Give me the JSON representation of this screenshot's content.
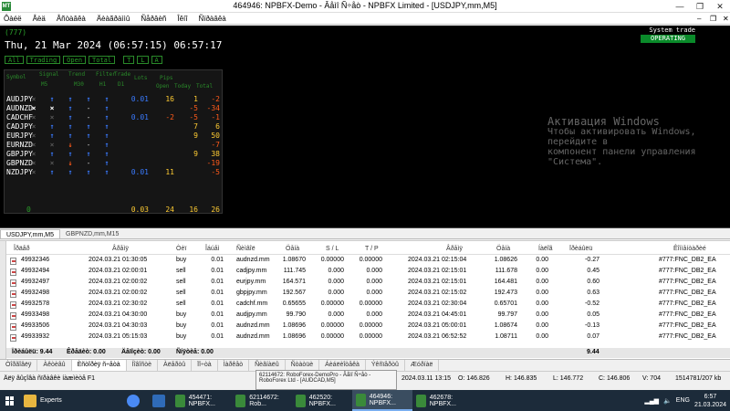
{
  "window": {
    "title": "464946: NPBFX-Demo - Âåìî Ñ÷åò - NPBFX Limited - [USDJPY,mm,M5]",
    "logo": "MT",
    "controls": [
      "—",
      "❐",
      "✕"
    ]
  },
  "menu": {
    "items": [
      "Ôàéë",
      "Âèä",
      "Âñòàâêà",
      "Äèàãðàììû",
      "Ñåðâèñ",
      "Îêíî",
      "Ñïðàâêà"
    ],
    "window_controls": [
      "–",
      "❐",
      "✕"
    ]
  },
  "chart": {
    "magic": "(777)",
    "datetime": "Thu, 21 Mar 2024 (06:57:15) 06:57:17",
    "filters": [
      "All",
      "Trading",
      "Open",
      "Total",
      "T",
      "L",
      "A"
    ],
    "system_label": "System trade",
    "system_status": "OPERATING",
    "table_headers": {
      "h1": "Symbol",
      "h2": "Signal",
      "h3": "Trend",
      "h4": "Filter",
      "h5": "Trade",
      "h6": "Lots",
      "h7": "Pips",
      "sub1": "M5",
      "sub2": "M30",
      "sub3": "H1",
      "sub4": "D1",
      "sub5": "Open",
      "sub6": "Today",
      "sub7": "Total"
    },
    "rows": [
      {
        "symbol": "AUDJPY",
        "c1": "×",
        "c2": "↑",
        "c3": "↑",
        "c4": "↑",
        "c5": "↑",
        "lots": "0.01",
        "open": "16",
        "today": "1",
        "total": "-2"
      },
      {
        "symbol": "AUDNZD",
        "c1": "×",
        "c2": "×",
        "c3": "↑",
        "c4": "-",
        "c5": "↑",
        "lots": "",
        "open": "",
        "today": "-5",
        "total": "-34"
      },
      {
        "symbol": "CADCHF",
        "c1": "×",
        "c2": "×",
        "c3": "↑",
        "c4": "-",
        "c5": "↑",
        "lots": "0.01",
        "open": "-2",
        "today": "-5",
        "total": "-1"
      },
      {
        "symbol": "CADJPY",
        "c1": "×",
        "c2": "↑",
        "c3": "↑",
        "c4": "↑",
        "c5": "↑",
        "lots": "",
        "open": "",
        "today": "7",
        "total": "6"
      },
      {
        "symbol": "EURJPY",
        "c1": "×",
        "c2": "↑",
        "c3": "↑",
        "c4": "↑",
        "c5": "↑",
        "lots": "",
        "open": "",
        "today": "9",
        "total": "50"
      },
      {
        "symbol": "EURNZD",
        "c1": "×",
        "c2": "×",
        "c3": "↓",
        "c4": "-",
        "c5": "↑",
        "lots": "",
        "open": "",
        "today": "",
        "total": "-7"
      },
      {
        "symbol": "GBPJPY",
        "c1": "×",
        "c2": "↑",
        "c3": "↑",
        "c4": "↑",
        "c5": "↑",
        "lots": "",
        "open": "",
        "today": "9",
        "total": "38"
      },
      {
        "symbol": "GBPNZD",
        "c1": "×",
        "c2": "×",
        "c3": "↓",
        "c4": "-",
        "c5": "↑",
        "lots": "",
        "open": "",
        "today": "",
        "total": "-19"
      },
      {
        "symbol": "NZDJPY",
        "c1": "×",
        "c2": "↑",
        "c3": "↑",
        "c4": "↑",
        "c5": "↑",
        "lots": "0.01",
        "open": "11",
        "today": "",
        "total": "-5"
      }
    ],
    "totals": {
      "zero": "0",
      "lots": "0.03",
      "open": "24",
      "today": "16",
      "total": "26"
    },
    "watermark_line1": "Активация Windows",
    "watermark_line2": "Чтобы активировать Windows, перейдите в",
    "watermark_line3": "компонент панели управления \"Система\"."
  },
  "chart_tabs": [
    "USDJPY,mm,M5",
    "GBPNZD,mm,M15"
  ],
  "terminal": {
    "headers": [
      "Îðäåð",
      "Âðåìÿ",
      "Òèï",
      "Îáúåì",
      "Ñèìâîë",
      "Öåíà",
      "S / L",
      "T / P",
      "Âðåìÿ",
      "Öåíà",
      "Íàëîã",
      "Ïðèáûëü",
      "Êîììåíòàðèé"
    ],
    "rows": [
      {
        "order": "49932346",
        "time": "2024.03.21 01:30:05",
        "type": "buy",
        "volume": "0.01",
        "symbol": "audnzd.mm",
        "price": "1.08670",
        "sl": "0.00000",
        "tp": "0.00000",
        "ctime": "2024.03.21 02:15:04",
        "cprice": "1.08626",
        "tax": "0.00",
        "profit": "-0.27",
        "comment": "#777:FNC_DB2_EA"
      },
      {
        "order": "49932494",
        "time": "2024.03.21 02:00:01",
        "type": "sell",
        "volume": "0.01",
        "symbol": "cadjpy.mm",
        "price": "111.745",
        "sl": "0.000",
        "tp": "0.000",
        "ctime": "2024.03.21 02:15:01",
        "cprice": "111.678",
        "tax": "0.00",
        "profit": "0.45",
        "comment": "#777:FNC_DB2_EA"
      },
      {
        "order": "49932497",
        "time": "2024.03.21 02:00:02",
        "type": "sell",
        "volume": "0.01",
        "symbol": "eurjpy.mm",
        "price": "164.571",
        "sl": "0.000",
        "tp": "0.000",
        "ctime": "2024.03.21 02:15:01",
        "cprice": "164.481",
        "tax": "0.00",
        "profit": "0.60",
        "comment": "#777:FNC_DB2_EA"
      },
      {
        "order": "49932498",
        "time": "2024.03.21 02:00:02",
        "type": "sell",
        "volume": "0.01",
        "symbol": "gbpjpy.mm",
        "price": "192.567",
        "sl": "0.000",
        "tp": "0.000",
        "ctime": "2024.03.21 02:15:02",
        "cprice": "192.473",
        "tax": "0.00",
        "profit": "0.63",
        "comment": "#777:FNC_DB2_EA"
      },
      {
        "order": "49932578",
        "time": "2024.03.21 02:30:02",
        "type": "sell",
        "volume": "0.01",
        "symbol": "cadchf.mm",
        "price": "0.65655",
        "sl": "0.00000",
        "tp": "0.00000",
        "ctime": "2024.03.21 02:30:04",
        "cprice": "0.65701",
        "tax": "0.00",
        "profit": "-0.52",
        "comment": "#777:FNC_DB2_EA"
      },
      {
        "order": "49933498",
        "time": "2024.03.21 04:30:00",
        "type": "buy",
        "volume": "0.01",
        "symbol": "audjpy.mm",
        "price": "99.790",
        "sl": "0.000",
        "tp": "0.000",
        "ctime": "2024.03.21 04:45:01",
        "cprice": "99.797",
        "tax": "0.00",
        "profit": "0.05",
        "comment": "#777:FNC_DB2_EA"
      },
      {
        "order": "49933506",
        "time": "2024.03.21 04:30:03",
        "type": "buy",
        "volume": "0.01",
        "symbol": "audnzd.mm",
        "price": "1.08696",
        "sl": "0.00000",
        "tp": "0.00000",
        "ctime": "2024.03.21 05:00:01",
        "cprice": "1.08674",
        "tax": "0.00",
        "profit": "-0.13",
        "comment": "#777:FNC_DB2_EA"
      },
      {
        "order": "49933932",
        "time": "2024.03.21 05:15:03",
        "type": "buy",
        "volume": "0.01",
        "symbol": "audnzd.mm",
        "price": "1.08696",
        "sl": "0.00000",
        "tp": "0.00000",
        "ctime": "2024.03.21 06:52:52",
        "cprice": "1.08711",
        "tax": "0.00",
        "profit": "0.07",
        "comment": "#777:FNC_DB2_EA"
      }
    ],
    "summary": {
      "profit_label": "Ïðèáûëü: 9.44",
      "credit_label": "Êðåäèò: 0.00",
      "deposit_label": "Äåïîçèò: 0.00",
      "withdraw_label": "Ñíÿòèå: 0.00",
      "total_profit": "9.44"
    }
  },
  "terminal_tabs": [
    "Òîðãîâëÿ",
    "Àêòèâû",
    "Èñòîðèÿ ñ÷åòà",
    "Íîâîñòè",
    "Àëåðòû",
    "Ïî÷òà",
    "Ìàðêåò",
    "Ñèãíàëû",
    "Ñòàòüè",
    "Áèáëèîòåêà",
    "Ýêñïåðòû",
    "Æóðíàë"
  ],
  "statusbar": {
    "help": "Äëÿ âûçîâà ñïðàâêè íàæìèòå F1",
    "date": "2024.03.11 13:15",
    "open": "O: 146.826",
    "high": "H: 146.835",
    "low": "L: 146.772",
    "close": "C: 146.806",
    "volume": "V: 704",
    "traffic": "1514781/207 kb"
  },
  "tooltip": {
    "line1": "62114672: RoboForex-DemoPro - Âåìî Ñ÷åò -",
    "line2": "RoboForex Ltd - [AUDCAD,M5]"
  },
  "taskbar": {
    "items": [
      {
        "label": "Experts",
        "icon": "folder-icon",
        "color": "#e8b640"
      },
      {
        "label": "",
        "icon": "chrome-icon",
        "color": "#4a8af4"
      },
      {
        "label": "",
        "icon": "powershell-icon",
        "color": "#2f6bb8"
      },
      {
        "label": "454471: NPBFX...",
        "icon": "metatrader-icon",
        "color": "#3a8a3a"
      },
      {
        "label": "62114672: Rob...",
        "icon": "metatrader-icon",
        "color": "#3a8a3a"
      },
      {
        "label": "462520: NPBFX...",
        "icon": "metatrader-icon",
        "color": "#3a8a3a"
      },
      {
        "label": "464946: NPBFX...",
        "icon": "metatrader-icon",
        "color": "#3a8a3a"
      },
      {
        "label": "462678: NPBFX...",
        "icon": "metatrader-icon",
        "color": "#3a8a3a"
      }
    ],
    "lang": "ENG",
    "time": "6:57",
    "date": "21.03.2024"
  }
}
